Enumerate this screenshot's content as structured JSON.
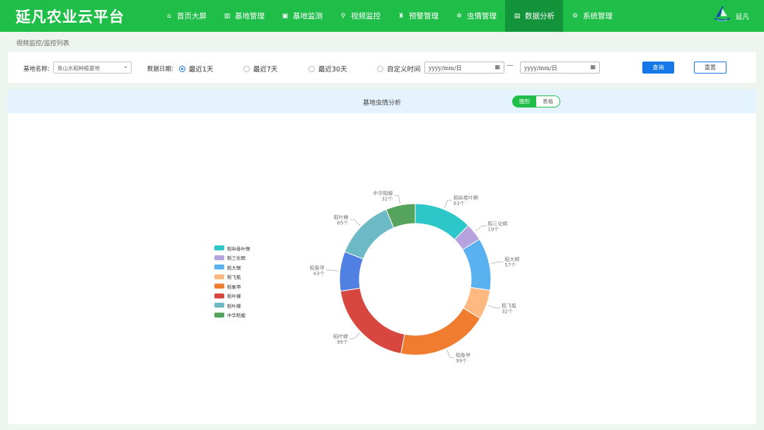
{
  "app": {
    "title": "延凡农业云平台",
    "user_name": "延凡"
  },
  "nav": [
    {
      "label": "首页大屏",
      "icon": "home-icon",
      "glyph": "⌂",
      "active": false
    },
    {
      "label": "基地管理",
      "icon": "map-icon",
      "glyph": "▥",
      "active": false
    },
    {
      "label": "基地监测",
      "icon": "monitor-icon",
      "glyph": "▣",
      "active": false
    },
    {
      "label": "视频监控",
      "icon": "location-pin-icon",
      "glyph": "⚲",
      "active": false
    },
    {
      "label": "预警管理",
      "icon": "alarm-icon",
      "glyph": "♜",
      "active": false
    },
    {
      "label": "虫情管理",
      "icon": "bug-icon",
      "glyph": "✲",
      "active": false
    },
    {
      "label": "数据分析",
      "icon": "bar-chart-icon",
      "glyph": "▤",
      "active": true
    },
    {
      "label": "系统管理",
      "icon": "gear-icon",
      "glyph": "⚙",
      "active": false
    }
  ],
  "breadcrumb": "视频监控/监控列表",
  "filter": {
    "base_label": "基地名称:",
    "base_value": "青山水稻种植基地",
    "date_label": "数据日期:",
    "radios": [
      {
        "label": "最近1天",
        "checked": true
      },
      {
        "label": "最近7天",
        "checked": false
      },
      {
        "label": "最近30天",
        "checked": false
      },
      {
        "label": "自定义时间",
        "checked": false
      }
    ],
    "start_placeholder": "yyyy/mm/日",
    "end_placeholder": "yyyy/mm/日",
    "separator": "—",
    "query_label": "查询",
    "reset_label": "重置"
  },
  "panel": {
    "title": "基地虫情分析",
    "toggle_chart": "图形",
    "toggle_table": "表格"
  },
  "chart_data": {
    "type": "pie",
    "unit": "个",
    "categories": [
      "稻纵卷叶螟",
      "稻三化螟",
      "稻大螟",
      "稻飞虱",
      "稻象甲",
      "稻叶蝉",
      "稻叶蝉",
      "中华稻蝗"
    ],
    "values": [
      63,
      19,
      57,
      32,
      99,
      99,
      43,
      65,
      32
    ],
    "slices": [
      {
        "name": "稻纵卷叶螟",
        "value": 63,
        "color": "#2ec7c9"
      },
      {
        "name": "稻三化螟",
        "value": 19,
        "color": "#b6a2de"
      },
      {
        "name": "稻大螟",
        "value": 57,
        "color": "#5ab1ef"
      },
      {
        "name": "稻飞虱",
        "value": 32,
        "color": "#ffb980"
      },
      {
        "name": "稻象甲",
        "value": 99,
        "color": "#f07c30"
      },
      {
        "name": "稻叶蝉",
        "value": 99,
        "color": "#d8473f"
      },
      {
        "name": "稻象甲",
        "value": 43,
        "color": "#4f80e2"
      },
      {
        "name": "稻叶蝉",
        "value": 65,
        "color": "#6bbac6"
      },
      {
        "name": "中华稻蝗",
        "value": 32,
        "color": "#55a35d"
      }
    ],
    "legend": [
      {
        "name": "稻纵卷叶螟",
        "color": "#2ec7c9"
      },
      {
        "name": "稻三化螟",
        "color": "#b6a2de"
      },
      {
        "name": "稻大螟",
        "color": "#5ab1ef"
      },
      {
        "name": "稻飞虱",
        "color": "#ffb980"
      },
      {
        "name": "稻象甲",
        "color": "#f07c30"
      },
      {
        "name": "稻叶蝉",
        "color": "#d8473f"
      },
      {
        "name": "稻叶蝉",
        "color": "#6bbac6"
      },
      {
        "name": "中华稻蝗",
        "color": "#55a35d"
      }
    ],
    "legend_placement": "left"
  }
}
